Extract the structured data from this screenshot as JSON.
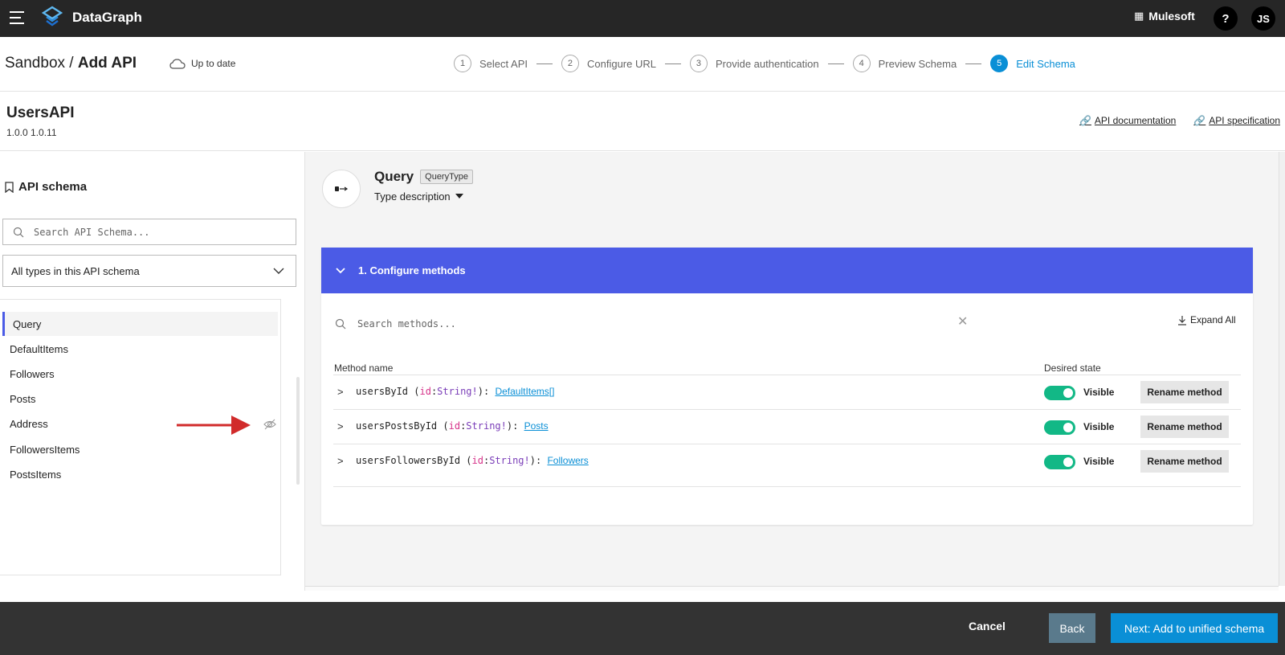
{
  "app": {
    "brand": "DataGraph",
    "org": "Mulesoft",
    "help": "?",
    "user_initials": "JS"
  },
  "header": {
    "crumb_root": "Sandbox /",
    "crumb_current": "Add API",
    "status": "Up to date",
    "steps": [
      {
        "num": "1",
        "label": "Select API"
      },
      {
        "num": "2",
        "label": "Configure URL"
      },
      {
        "num": "3",
        "label": "Provide authentication"
      },
      {
        "num": "4",
        "label": "Preview Schema"
      },
      {
        "num": "5",
        "label": "Edit Schema"
      }
    ]
  },
  "api": {
    "name": "UsersAPI",
    "version": "1.0.0 1.0.11",
    "doc_link": "API documentation",
    "spec_link": "API specification"
  },
  "sidebar": {
    "title": "API schema",
    "search_placeholder": "Search API Schema...",
    "filter_value": "All types in this API schema",
    "types": [
      "Query",
      "DefaultItems",
      "Followers",
      "Posts",
      "Address",
      "FollowersItems",
      "PostsItems"
    ],
    "selected": "Query"
  },
  "detail": {
    "type_name": "Query",
    "type_badge": "QueryType",
    "type_description": "Type description",
    "section_title": "1. Configure methods",
    "search_placeholder": "Search methods...",
    "expand_all": "Expand All",
    "col_method": "Method name",
    "col_state": "Desired state",
    "methods": [
      {
        "name": "usersById",
        "arg": "id",
        "arg_type": "String!",
        "returns": "DefaultItems[]",
        "state": "Visible",
        "rename": "Rename method"
      },
      {
        "name": "usersPostsById",
        "arg": "id",
        "arg_type": "String!",
        "returns": "Posts",
        "state": "Visible",
        "rename": "Rename method"
      },
      {
        "name": "usersFollowersById",
        "arg": "id",
        "arg_type": "String!",
        "returns": "Followers",
        "state": "Visible",
        "rename": "Rename method"
      }
    ]
  },
  "footer": {
    "cancel": "Cancel",
    "back": "Back",
    "next": "Next: Add to unified schema"
  },
  "colors": {
    "accent": "#4b5be6",
    "primary": "#0a8fd6",
    "toggle_on": "#12b886",
    "annotation_arrow": "#d12b2b"
  }
}
